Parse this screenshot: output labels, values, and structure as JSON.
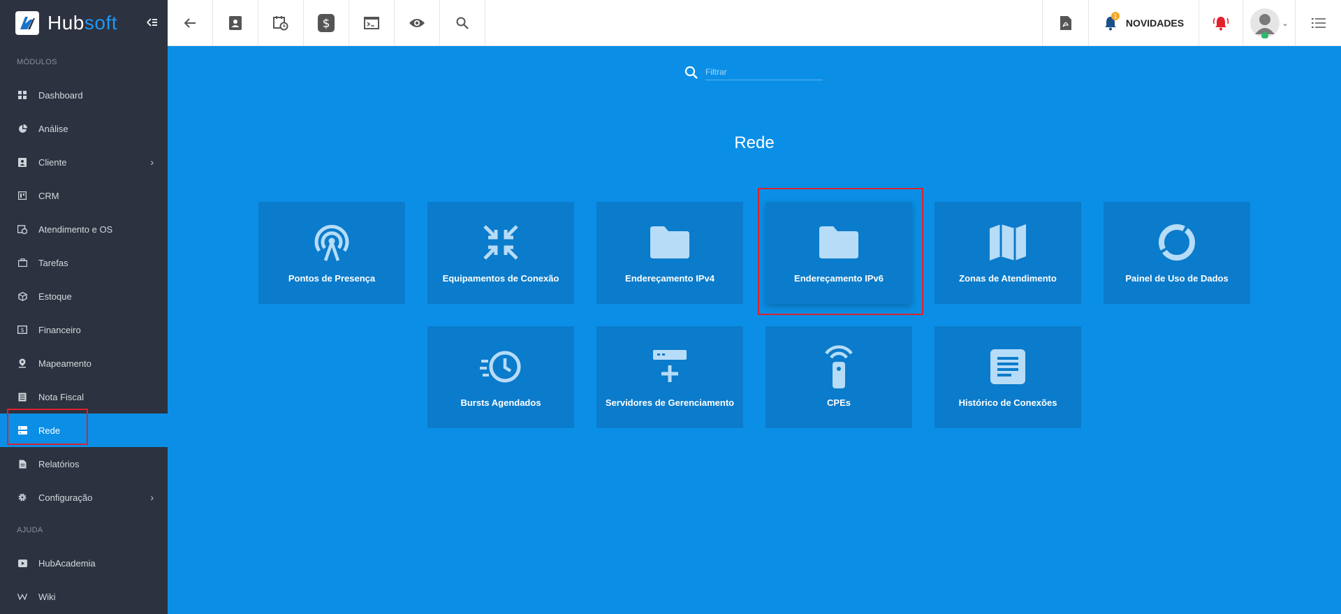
{
  "brand": {
    "name_a": "Hub",
    "name_b": "soft"
  },
  "sidebar": {
    "modules_label": "MÓDULOS",
    "help_label": "AJUDA",
    "items": [
      {
        "label": "Dashboard",
        "icon": "grid-icon"
      },
      {
        "label": "Análise",
        "icon": "pie-chart-icon"
      },
      {
        "label": "Cliente",
        "icon": "contact-card-icon"
      },
      {
        "label": "CRM",
        "icon": "board-icon"
      },
      {
        "label": "Atendimento e OS",
        "icon": "calendar-clock-icon"
      },
      {
        "label": "Tarefas",
        "icon": "briefcase-icon"
      },
      {
        "label": "Estoque",
        "icon": "box-icon"
      },
      {
        "label": "Financeiro",
        "icon": "money-icon"
      },
      {
        "label": "Mapeamento",
        "icon": "map-pin-icon"
      },
      {
        "label": "Nota Fiscal",
        "icon": "receipt-icon"
      },
      {
        "label": "Rede",
        "icon": "server-icon"
      },
      {
        "label": "Relatórios",
        "icon": "document-icon"
      },
      {
        "label": "Configuração",
        "icon": "gear-icon"
      }
    ],
    "help_items": [
      {
        "label": "HubAcademia",
        "icon": "play-icon"
      },
      {
        "label": "Wiki",
        "icon": "wiki-icon"
      }
    ]
  },
  "topbar": {
    "news_label": "NOVIDADES",
    "news_badge": "1"
  },
  "main": {
    "filter_placeholder": "Filtrar",
    "title": "Rede",
    "cards": [
      {
        "label": "Pontos de Presença",
        "icon": "antenna-icon"
      },
      {
        "label": "Equipamentos de Conexão",
        "icon": "compress-arrows-icon"
      },
      {
        "label": "Endereçamento IPv4",
        "icon": "folder-icon"
      },
      {
        "label": "Endereçamento IPv6",
        "icon": "folder-icon"
      },
      {
        "label": "Zonas de Atendimento",
        "icon": "map-icon"
      },
      {
        "label": "Painel de Uso de Dados",
        "icon": "donut-icon"
      },
      {
        "label": "Bursts Agendados",
        "icon": "clock-speed-icon"
      },
      {
        "label": "Servidores de Gerenciamento",
        "icon": "server-add-icon"
      },
      {
        "label": "CPEs",
        "icon": "remote-signal-icon"
      },
      {
        "label": "Histórico de Conexões",
        "icon": "text-document-icon"
      }
    ]
  },
  "colors": {
    "sidebar_bg": "#2c323f",
    "main_bg": "#0b8fe6",
    "card_bg": "#0b7bcb",
    "icon_light": "#b7dcf7",
    "highlight": "#d9232d"
  }
}
